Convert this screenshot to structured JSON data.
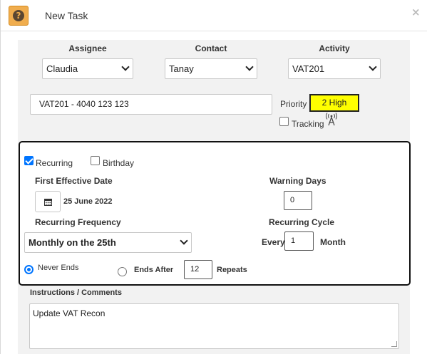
{
  "dialog": {
    "title": "New Task",
    "help_icon_glyph": "?"
  },
  "assignment": {
    "assignee_label": "Assignee",
    "assignee_value": "Claudia",
    "contact_label": "Contact",
    "contact_value": "Tanay",
    "activity_label": "Activity",
    "activity_value": "VAT201"
  },
  "task": {
    "name_value": "VAT201 - 4040 123 123",
    "priority_label": "Priority",
    "priority_value": "2 High",
    "priority_color": "#ffff00",
    "tracking_label": "Tracking",
    "tracking_checked": false,
    "tracking_icon": "antenna-icon"
  },
  "recurrence": {
    "recurring_label": "Recurring",
    "recurring_checked": true,
    "birthday_label": "Birthday",
    "birthday_checked": false,
    "first_effective_date_label": "First Effective Date",
    "first_effective_date_value": "25 June 2022",
    "warning_days_label": "Warning Days",
    "warning_days_value": "0",
    "frequency_label": "Recurring Frequency",
    "frequency_value": "Monthly on the 25th",
    "cycle_label": "Recurring Cycle",
    "cycle_every_label": "Every",
    "cycle_value": "1",
    "cycle_unit_label": "Month",
    "never_ends_label": "Never Ends",
    "never_ends_checked": true,
    "ends_after_label": "Ends After",
    "ends_after_checked": false,
    "repeats_value": "12",
    "repeats_label": "Repeats"
  },
  "comments": {
    "label": "Instructions / Comments",
    "value": "Update VAT Recon"
  },
  "colors": {
    "accent": "#0075ff",
    "help_icon_bg": "#f0ad4e",
    "panel_bg": "#f2f2f2"
  }
}
